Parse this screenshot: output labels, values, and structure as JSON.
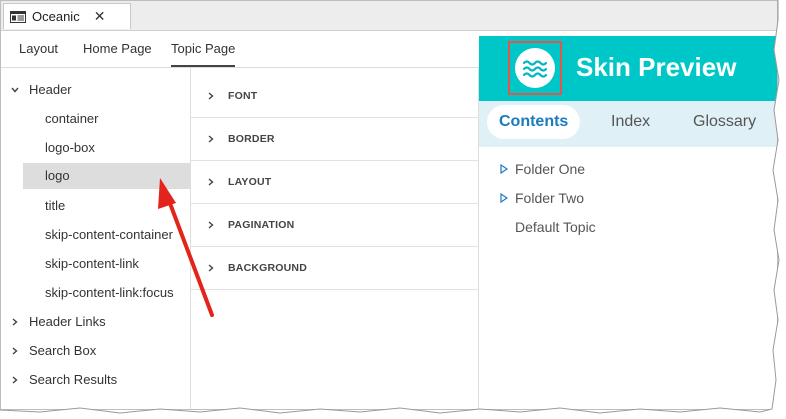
{
  "window_tab": {
    "title": "Oceanic",
    "close_label": "✕"
  },
  "subtabs": [
    {
      "label": "Layout"
    },
    {
      "label": "Home Page"
    },
    {
      "label": "Topic Page"
    }
  ],
  "tree": {
    "items": [
      {
        "label": "Header"
      },
      {
        "label": "container"
      },
      {
        "label": "logo-box"
      },
      {
        "label": "logo"
      },
      {
        "label": "title"
      },
      {
        "label": "skip-content-container"
      },
      {
        "label": "skip-content-link"
      },
      {
        "label": "skip-content-link:focus"
      },
      {
        "label": "Header Links"
      },
      {
        "label": "Search Box"
      },
      {
        "label": "Search Results"
      }
    ]
  },
  "properties": [
    {
      "label": "FONT"
    },
    {
      "label": "BORDER"
    },
    {
      "label": "LAYOUT"
    },
    {
      "label": "PAGINATION"
    },
    {
      "label": "BACKGROUND"
    }
  ],
  "preview": {
    "title": "Skin Preview",
    "tabs": [
      {
        "label": "Contents"
      },
      {
        "label": "Index"
      },
      {
        "label": "Glossary"
      }
    ],
    "toc": [
      {
        "label": "Folder One"
      },
      {
        "label": "Folder Two"
      },
      {
        "label": "Default Topic"
      }
    ]
  },
  "colors": {
    "header_teal": "#00c7c7",
    "tabs_bar": "#dff1f7",
    "accent_blue": "#1a7bbf",
    "annotation_red": "#e2241c",
    "selection_gray": "#dddddd"
  },
  "icons": {
    "doc_tab": "window-icon",
    "logo": "waves-icon",
    "expand": "chevron-right-icon",
    "collapse": "chevron-down-icon",
    "toc_expand": "triangle-right-icon"
  }
}
